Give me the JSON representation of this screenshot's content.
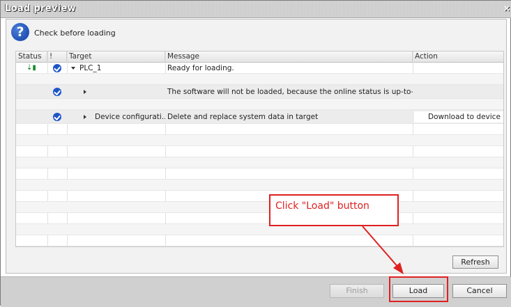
{
  "window": {
    "title": "Load preview",
    "close_glyph": "×"
  },
  "header": {
    "icon": "help-question-icon",
    "text": "Check before loading"
  },
  "table": {
    "columns": [
      "Status",
      "!",
      "Target",
      "Message",
      "Action"
    ],
    "rows": [
      {
        "status_icon": "status-load-icon",
        "check": true,
        "expander": "expanded",
        "target": "PLC_1",
        "message": "Ready for loading.",
        "action": ""
      },
      {
        "status_icon": "",
        "check": false,
        "expander": "",
        "target": "",
        "message": "",
        "action": ""
      },
      {
        "status_icon": "",
        "check": true,
        "expander": "collapsed",
        "target": "",
        "message": "The software will not be loaded, because the online status is up-to-...",
        "action": ""
      },
      {
        "status_icon": "",
        "check": false,
        "expander": "",
        "target": "",
        "message": "",
        "action": ""
      },
      {
        "status_icon": "",
        "check": true,
        "expander": "collapsed",
        "target": "Device configurati...",
        "message": "Delete and replace system data in target",
        "action": "Download to device"
      }
    ]
  },
  "buttons": {
    "refresh": "Refresh",
    "finish": "Finish",
    "load": "Load",
    "cancel": "Cancel"
  },
  "annotation": {
    "text": "Click \"Load\" button",
    "color": "#e02020"
  },
  "colors": {
    "accent": "#1d55c9",
    "annotation": "#e02020",
    "status_green": "#1b8a2e"
  }
}
